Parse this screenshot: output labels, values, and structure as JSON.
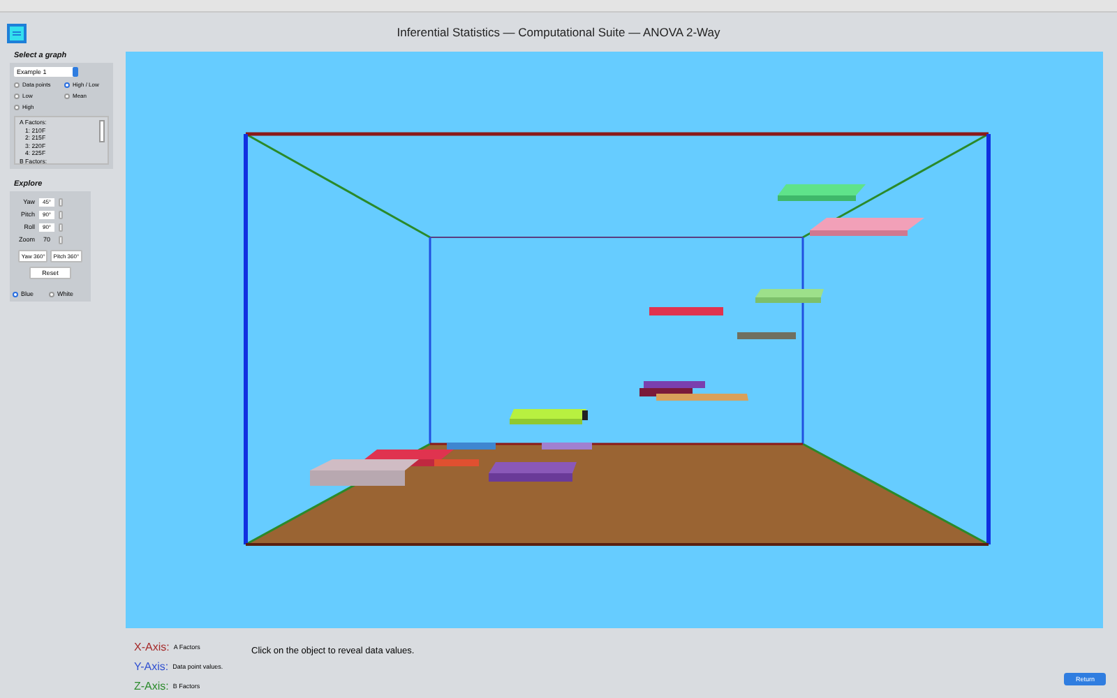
{
  "window": {
    "title": "Inferential Statistics — Computational Suite — ANOVA 2-Way"
  },
  "select_graph": {
    "title": "Select a graph",
    "dropdown": {
      "value": "Example 1"
    },
    "options": [
      {
        "label": "Data points",
        "selected": false
      },
      {
        "label": "High / Low",
        "selected": true
      },
      {
        "label": "Low",
        "selected": false
      },
      {
        "label": "Mean",
        "selected": false
      },
      {
        "label": "High",
        "selected": false
      }
    ],
    "factors_list": [
      "A Factors:",
      "1: 210F",
      "2: 215F",
      "3: 220F",
      "4: 225F",
      "B Factors:"
    ]
  },
  "explore": {
    "title": "Explore",
    "controls": [
      {
        "label": "Yaw",
        "value": "45°",
        "kind": "field"
      },
      {
        "label": "Pitch",
        "value": "90°",
        "kind": "field"
      },
      {
        "label": "Roll",
        "value": "90°",
        "kind": "field"
      },
      {
        "label": "Zoom",
        "value": "70",
        "kind": "text"
      }
    ],
    "spin_buttons": [
      "Yaw 360°",
      "Pitch 360°"
    ],
    "reset_button": "Reset",
    "background_options": [
      {
        "label": "Blue",
        "selected": true
      },
      {
        "label": "White",
        "selected": false
      }
    ]
  },
  "axes": [
    {
      "label": "X-Axis:",
      "description": "A Factors",
      "color": "#a52a2a"
    },
    {
      "label": "Y-Axis:",
      "description": "Data point values.",
      "color": "#3050d0"
    },
    {
      "label": "Z-Axis:",
      "description": "B Factors",
      "color": "#2a8a2a"
    }
  ],
  "message": "Click on the object to reveal data values.",
  "return_button": "Return"
}
